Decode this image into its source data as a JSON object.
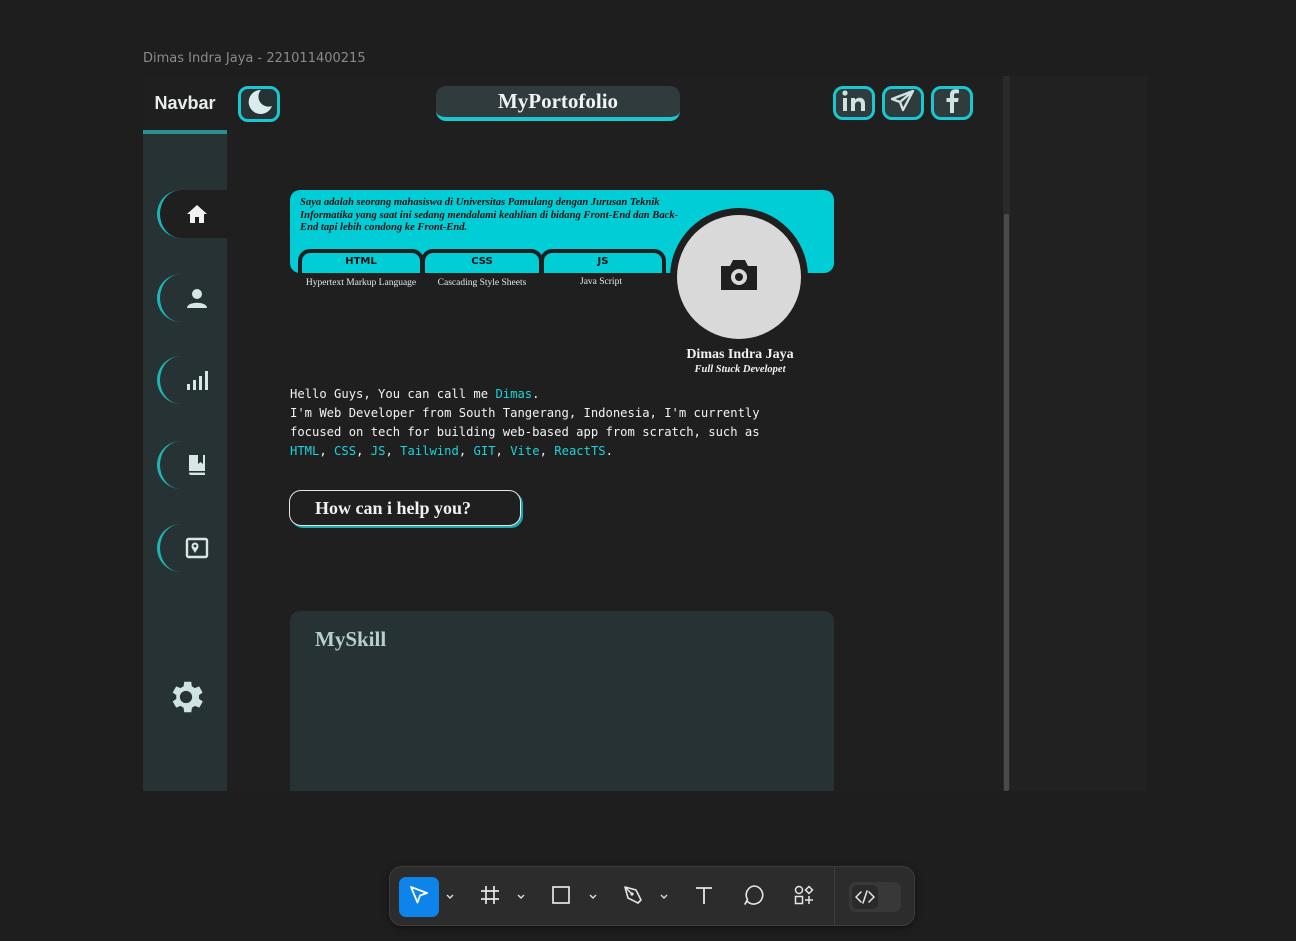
{
  "canvas": {
    "frame_label": "Dimas Indra Jaya - 221011400215"
  },
  "sidebar": {
    "title": "Navbar",
    "items": [
      {
        "icon": "home-icon",
        "active": true
      },
      {
        "icon": "user-icon",
        "active": false
      },
      {
        "icon": "bar-chart-icon",
        "active": false
      },
      {
        "icon": "book-icon",
        "active": false
      },
      {
        "icon": "map-pin-icon",
        "active": false
      }
    ],
    "settings_icon": "gear-icon"
  },
  "header": {
    "theme_icon": "moon-icon",
    "brand": "MyPortofolio",
    "socials": [
      "linkedin-icon",
      "telegram-icon",
      "facebook-icon"
    ]
  },
  "hero": {
    "description": "Saya adalah seorang mahasiswa di Universitas Pamulang dengan Jurusan Teknik Informatika yang saat ini sedang mendalami keahlian di bidang Front-End dan Back-End tapi lebih condong ke Front-End.",
    "tags": [
      {
        "label": "HTML",
        "sub": "Hypertext Markup Language"
      },
      {
        "label": "CSS",
        "sub": "Cascading Style Sheets"
      },
      {
        "label": "JS",
        "sub": "Java Script"
      }
    ],
    "avatar_icon": "camera-icon",
    "name": "Dimas Indra Jaya",
    "role": "Full Stuck Developet"
  },
  "intro": {
    "greeting": "Hello Guys, You can call me ",
    "name": "Dimas",
    "greeting_end": ".",
    "line2": "I'm Web Developer from South Tangerang, Indonesia, I'm currently",
    "line3": "focused on tech for building web-based app from scratch, such as",
    "skills": [
      "HTML",
      "CSS",
      "JS",
      "Tailwind",
      "GIT",
      "Vite",
      "ReactTS"
    ],
    "separator": ", ",
    "end": "."
  },
  "cta": {
    "label": "How can i help you?"
  },
  "skills_section": {
    "title": "MySkill"
  },
  "toolbar": {
    "tools": [
      "move-icon",
      "frame-icon",
      "rectangle-icon",
      "pen-icon",
      "text-icon",
      "comment-icon",
      "components-icon"
    ],
    "dev_mode_icon": "code-icon"
  },
  "colors": {
    "accent": "#18c7cf",
    "card_bg": "#263233",
    "hero_bg": "#00cdd6",
    "toolbar_active": "#0d84e9"
  }
}
